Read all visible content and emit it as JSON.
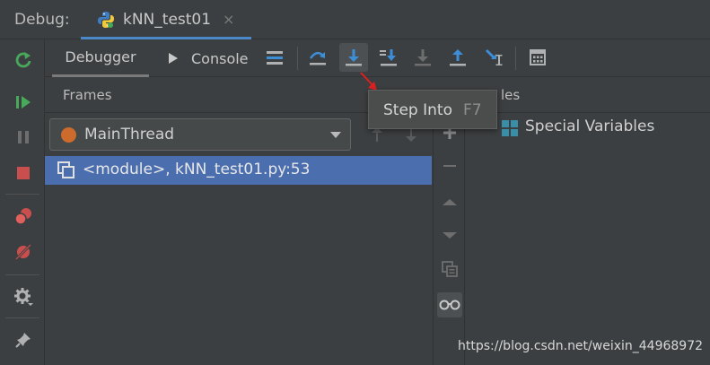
{
  "window": {
    "debug_label": "Debug:",
    "tab_label": "kNN_test01",
    "tab_close": "×"
  },
  "toolbar": {
    "tabs": [
      {
        "label": "Debugger",
        "active": true
      },
      {
        "label": "Console",
        "active": false
      }
    ],
    "step_buttons": [
      {
        "name": "step-over-icon",
        "enabled": true
      },
      {
        "name": "step-into-icon",
        "enabled": true,
        "hovered": true
      },
      {
        "name": "step-into-my-code-icon",
        "enabled": true
      },
      {
        "name": "force-step-into-icon",
        "enabled": false
      },
      {
        "name": "step-out-icon",
        "enabled": true
      },
      {
        "name": "run-to-cursor-icon",
        "enabled": true
      },
      {
        "name": "evaluate-expression-icon",
        "enabled": true
      }
    ]
  },
  "left_toolbar": [
    "rerun-icon",
    "resume-icon",
    "pause-icon",
    "stop-icon",
    "view-breakpoints-icon",
    "mute-breakpoints-icon",
    "settings-icon",
    "pin-icon"
  ],
  "frames": {
    "title": "Frames",
    "thread": "MainThread",
    "items": [
      {
        "label": "<module>, kNN_test01.py:53"
      }
    ]
  },
  "variables": {
    "title_partial": "les",
    "items": [
      {
        "label": "Special Variables"
      }
    ]
  },
  "tooltip": {
    "text": "Step Into",
    "shortcut": "F7"
  },
  "watermark": "https://blog.csdn.net/weixin_44968972",
  "colors": {
    "background": "#3c3f41",
    "selection": "#4b6eaf",
    "accent_blue": "#3d8ed6",
    "green": "#48a95a",
    "red": "#c94f4f",
    "thread_dot": "#cc6b2c"
  }
}
